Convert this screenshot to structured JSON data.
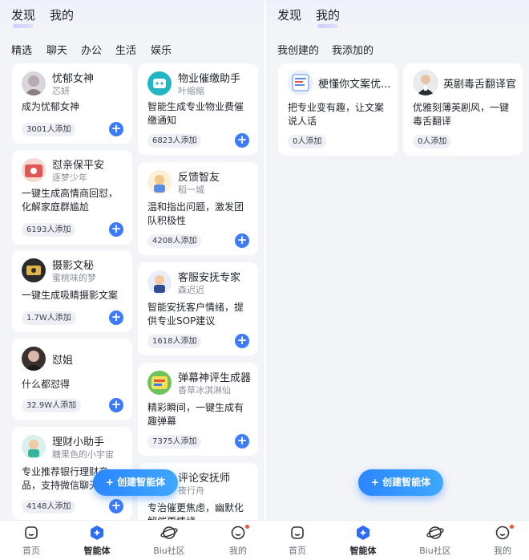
{
  "left": {
    "top_tabs": [
      "发现",
      "我的"
    ],
    "categories": [
      "精选",
      "聊天",
      "办公",
      "生活",
      "娱乐"
    ],
    "col1": [
      {
        "title": "忧郁女神",
        "author": "芯妍",
        "desc": "成为忧郁女神",
        "count": "3001人添加"
      },
      {
        "title": "怼亲保平安",
        "author": "逐梦少年",
        "desc": "一键生成高情商回怼，化解家庭群尴尬",
        "count": "6193人添加"
      },
      {
        "title": "摄影文秘",
        "author": "蜜桃味的梦",
        "desc": "一键生成吸睛摄影文案",
        "count": "1.7W人添加"
      },
      {
        "title": "怼姐",
        "author": "",
        "desc": "什么都怼得",
        "count": "32.9W人添加"
      },
      {
        "title": "理财小助手",
        "author": "糖果色的小宇宙",
        "desc": "专业推荐银行理财产品，支持微信聊天",
        "count": "4148人添加"
      }
    ],
    "col2": [
      {
        "title": "物业催缴助手",
        "author": "叶缩缩",
        "desc": "智能生成专业物业费催缴通知",
        "count": "6823人添加"
      },
      {
        "title": "反馈智友",
        "author": "稻一城",
        "desc": "温和指出问题，激发团队积极性",
        "count": "4208人添加"
      },
      {
        "title": "客服安抚专家",
        "author": "森迟迟",
        "desc": "智能安抚客户情绪，提供专业SOP建议",
        "count": "1618人添加"
      },
      {
        "title": "弹幕神评生成器",
        "author": "香草冰淇淋仙",
        "desc": "精彩瞬间，一键生成有趣弹幕",
        "count": "7375人添加"
      },
      {
        "title": "评论安抚师",
        "author": "夜行舟",
        "desc": "专治催更焦虑，幽默化解催更情绪",
        "count": ""
      }
    ],
    "create_label": "+ 创建智能体"
  },
  "right": {
    "top_tabs": [
      "发现",
      "我的"
    ],
    "sub_tabs": [
      "我创建的",
      "我添加的"
    ],
    "cards": [
      {
        "title": "梗懂你文案优...",
        "desc": "把专业变有趣，让文案说人话",
        "count": "0人添加"
      },
      {
        "title": "英剧毒舌翻译官",
        "desc": "优雅刻薄英剧风，一键毒舌翻译",
        "count": "0人添加"
      }
    ],
    "create_label": "+ 创建智能体"
  },
  "tabbar": [
    "首页",
    "智能体",
    "Biu社区",
    "我的"
  ],
  "colors": {
    "accent": "#3e7bfa",
    "bg": "#f3f4f8",
    "badge": "#eef0f6"
  }
}
